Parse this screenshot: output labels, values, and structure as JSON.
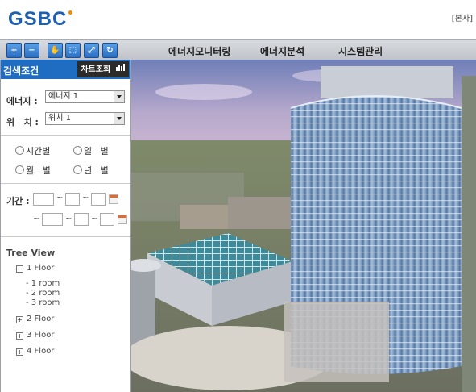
{
  "header": {
    "logo": "GSBC",
    "top_link": "[본사]"
  },
  "toolbar": {
    "tools": [
      "zoom-in",
      "zoom-out",
      "pan",
      "select",
      "fullscreen",
      "refresh"
    ],
    "menu": [
      "에너지모니터링",
      "에너지분석",
      "시스템관리"
    ]
  },
  "sidebar": {
    "title": "검색조건",
    "chart_button": "차트조회",
    "energy_label": "에너지 :",
    "energy_value": "에너지 1",
    "location_label": "위   치 :",
    "location_value": "위치 1",
    "periods": [
      "시간별",
      "일   별",
      "월   별",
      "년   별"
    ],
    "period_label": "기간 :",
    "tilde": "~",
    "tree": {
      "title": "Tree View",
      "floor1": "1 Floor",
      "rooms": [
        "1 room",
        "2 room",
        "3 room"
      ],
      "floor2": "2 Floor",
      "floor3": "3 Floor",
      "floor4": "4 Floor"
    }
  },
  "colors": {
    "accent": "#1f6dc3",
    "toolbar_button": "#2a6fc2"
  }
}
